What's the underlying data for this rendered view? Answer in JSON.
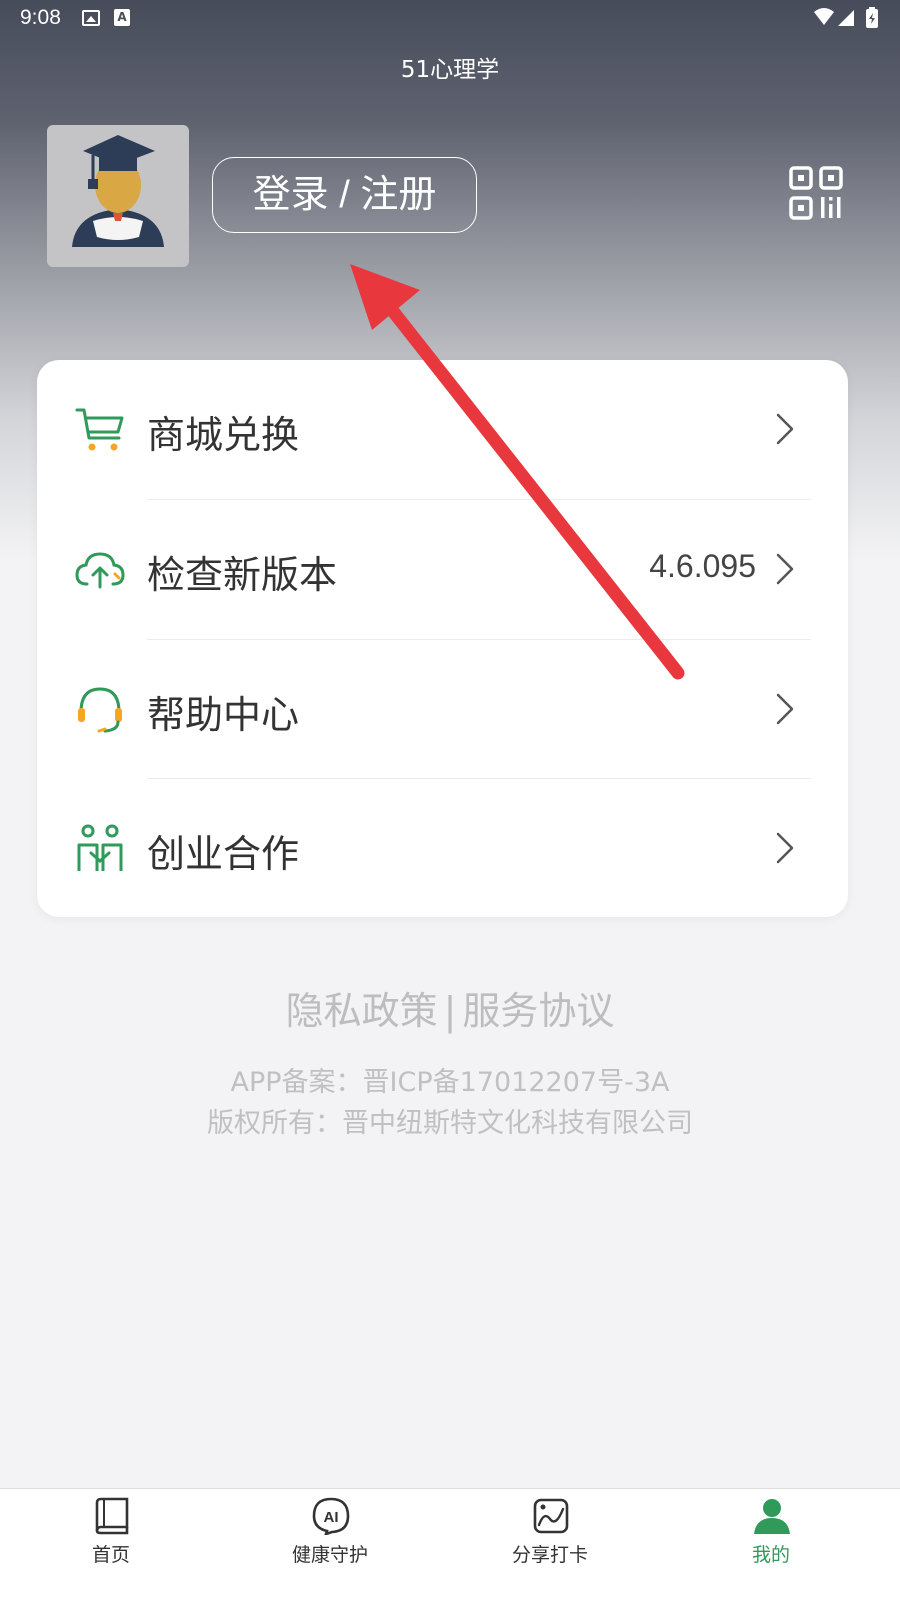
{
  "status_bar": {
    "time": "9:08",
    "a_badge": "A"
  },
  "header": {
    "title": "51心理学"
  },
  "profile": {
    "login_label": "登录 / 注册"
  },
  "menu": {
    "items": [
      {
        "label": "商城兑换",
        "value": "",
        "icon": "cart-icon"
      },
      {
        "label": "检查新版本",
        "value": "4.6.095",
        "icon": "cloud-upload-icon"
      },
      {
        "label": "帮助中心",
        "value": "",
        "icon": "headset-icon"
      },
      {
        "label": "创业合作",
        "value": "",
        "icon": "partners-icon"
      }
    ]
  },
  "footer": {
    "privacy": "隐私政策",
    "separator": "|",
    "service": "服务协议",
    "icp": "APP备案：晋ICP备17012207号-3A",
    "copyright": "版权所有：晋中纽斯特文化科技有限公司"
  },
  "tabbar": {
    "tabs": [
      {
        "label": "首页",
        "icon": "book-icon",
        "active": false
      },
      {
        "label": "健康守护",
        "icon": "ai-icon",
        "active": false
      },
      {
        "label": "分享打卡",
        "icon": "chart-card-icon",
        "active": false
      },
      {
        "label": "我的",
        "icon": "person-icon",
        "active": true
      }
    ]
  },
  "colors": {
    "accent": "#2f9a5a",
    "icon_orange": "#f5a623",
    "arrow_red": "#e8383d"
  }
}
